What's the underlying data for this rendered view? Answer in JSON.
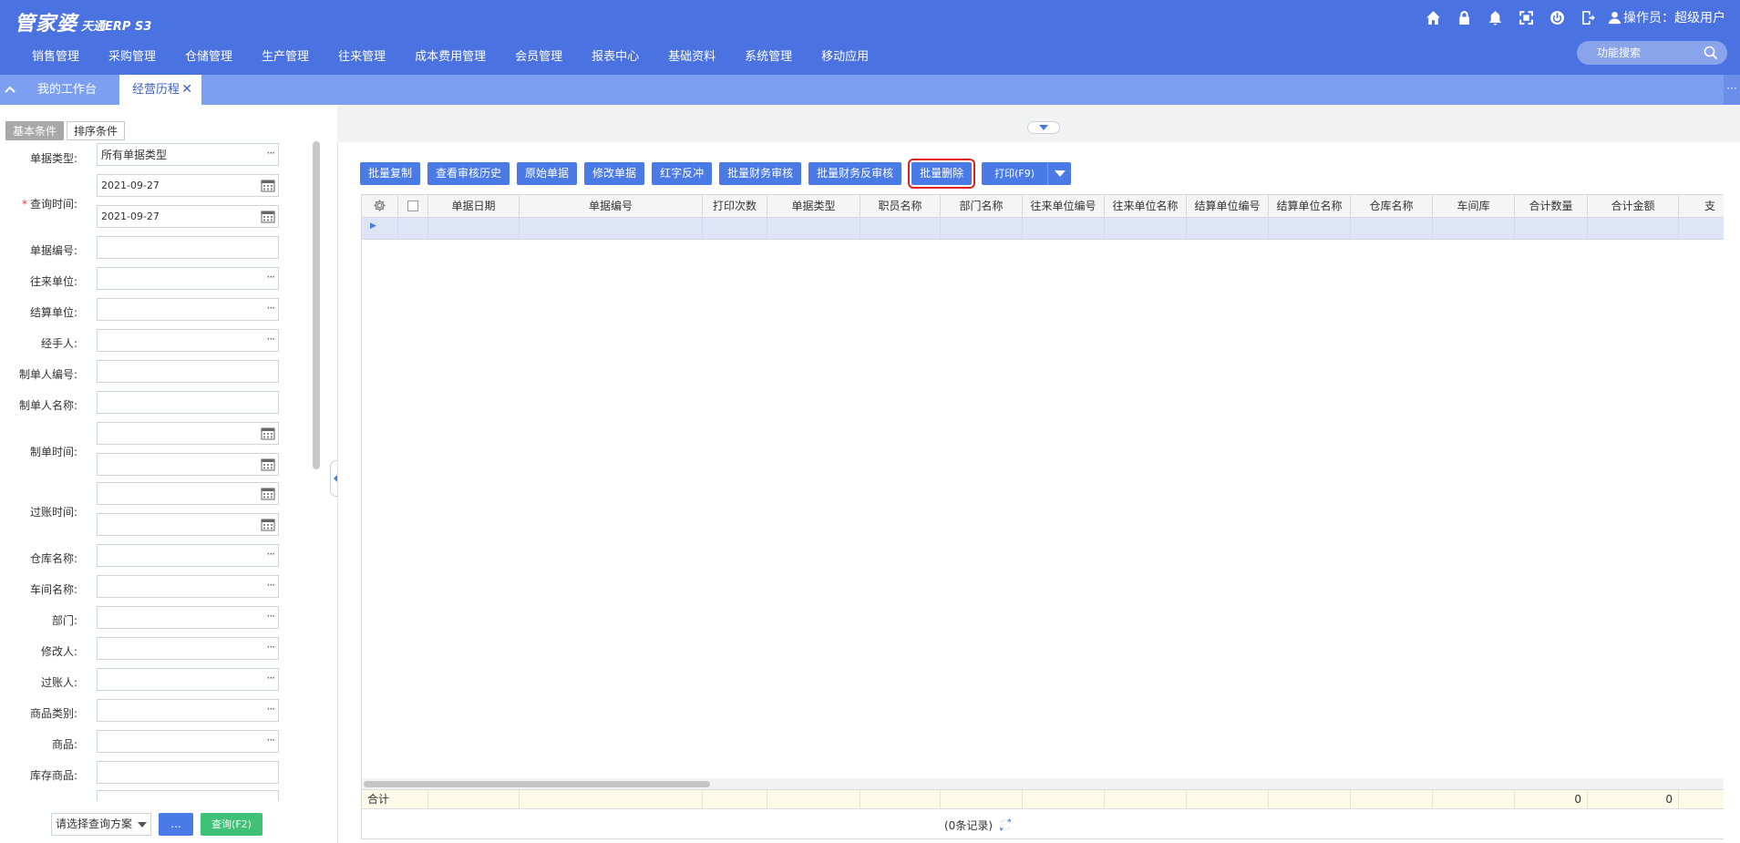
{
  "header": {
    "logo_main": "管家婆",
    "logo_sub": "天通ERP S3",
    "operator_label": "操作员：超级用户",
    "search_placeholder": "功能搜索"
  },
  "nav": [
    "销售管理",
    "采购管理",
    "仓储管理",
    "生产管理",
    "往来管理",
    "成本费用管理",
    "会员管理",
    "报表中心",
    "基础资料",
    "系统管理",
    "移动应用"
  ],
  "tabs": {
    "workbench": "我的工作台",
    "current": "经营历程",
    "close": "✕"
  },
  "query_panel": {
    "tab_basic": "基本条件",
    "tab_sort": "排序条件",
    "labels": {
      "bill_type": "单据类型:",
      "query_time": "查询时间:",
      "bill_no": "单据编号:",
      "partner": "往来单位:",
      "settle_unit": "结算单位:",
      "handler": "经手人:",
      "creator_no": "制单人编号:",
      "creator_name": "制单人名称:",
      "create_time": "制单时间:",
      "post_time": "过账时间:",
      "warehouse": "仓库名称:",
      "workshop": "车间名称:",
      "dept": "部门:",
      "modifier": "修改人:",
      "poster": "过账人:",
      "goods_cat": "商品类别:",
      "goods": "商品:",
      "stock_goods": "库存商品:"
    },
    "values": {
      "bill_type": "所有单据类型",
      "date_from": "2021-09-27",
      "date_to": "2021-09-27"
    },
    "scheme_select": "请选择查询方案",
    "dots_button": "...",
    "query_button": "查询(F2)"
  },
  "toolbar": [
    {
      "label": "批量复制"
    },
    {
      "label": "查看审核历史"
    },
    {
      "label": "原始单据"
    },
    {
      "label": "修改单据"
    },
    {
      "label": "红字反冲"
    },
    {
      "label": "批量财务审核"
    },
    {
      "label": "批量财务反审核"
    },
    {
      "label": "批量删除"
    }
  ],
  "print_button": "打印(F9)",
  "grid": {
    "columns": [
      "单据日期",
      "单据编号",
      "打印次数",
      "单据类型",
      "职员名称",
      "部门名称",
      "往来单位编号",
      "往来单位名称",
      "结算单位编号",
      "结算单位名称",
      "仓库名称",
      "车间库",
      "合计数量",
      "合计金额",
      "支"
    ],
    "row_marker": "▶",
    "total_label": "合计",
    "total_qty": "0",
    "total_amount": "0",
    "footer": "(0条记录)"
  },
  "colors": {
    "header_bg": "#4a72e0",
    "tab_bg": "#7c9ff2",
    "button_blue": "#4a7ae6",
    "button_green": "#3fc177",
    "highlight": "#e02020"
  }
}
